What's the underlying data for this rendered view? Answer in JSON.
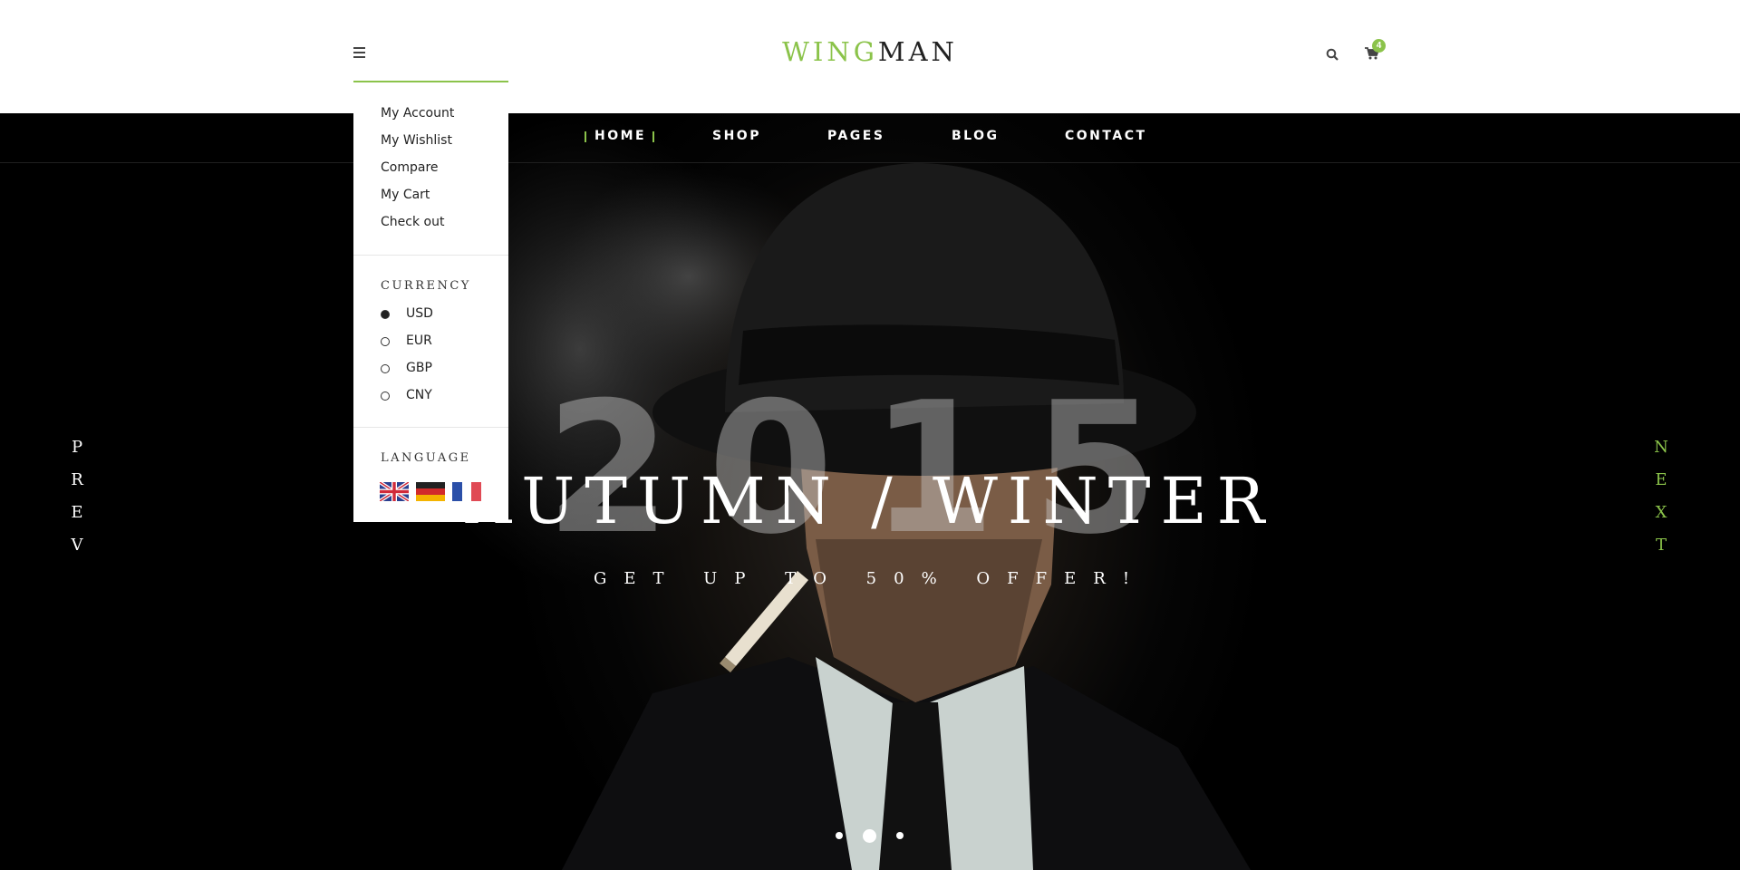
{
  "header": {
    "logo_part1": "WING",
    "logo_part2": "MAN",
    "cart_count": "4",
    "accent_color": "#8bc34a"
  },
  "nav": {
    "items": [
      "HOME",
      "SHOP",
      "PAGES",
      "BLOG",
      "CONTACT"
    ],
    "active": "HOME"
  },
  "dropdown": {
    "links": [
      "My Account",
      "My Wishlist",
      "Compare",
      "My Cart",
      "Check out"
    ],
    "currency_heading": "CURRENCY",
    "currencies": [
      "USD",
      "EUR",
      "GBP",
      "CNY"
    ],
    "selected_currency": "USD",
    "language_heading": "LANGUAGE",
    "languages": [
      "uk-flag-icon",
      "germany-flag-icon",
      "france-flag-icon"
    ]
  },
  "hero": {
    "year": "2015",
    "headline": "AUTUMN / WINTER",
    "subline": "GET UP TO 50% OFFER!",
    "prev_label": [
      "P",
      "R",
      "E",
      "V"
    ],
    "next_label": [
      "N",
      "E",
      "X",
      "T"
    ],
    "slide_count": 3,
    "active_slide": 2
  }
}
